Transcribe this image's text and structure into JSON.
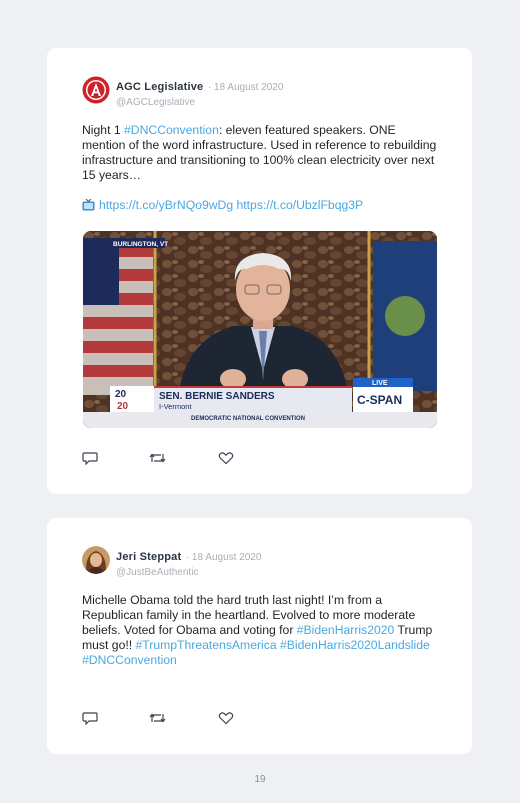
{
  "page_number": "19",
  "tweets": [
    {
      "name": "AGC Legislative",
      "date": "· 18 August 2020",
      "handle": "@AGCLegislative",
      "avatar_icon": "agc-logo-icon",
      "text_segments": [
        {
          "text": "Night 1 ",
          "tag": false
        },
        {
          "text": "#DNCConvention",
          "tag": true
        },
        {
          "text": ": eleven featured speakers. ONE mention of the word infrastructure. Used in reference to rebuilding infrastructure and transitioning to 100% clean electricity over next 15 years…",
          "tag": false
        }
      ],
      "links": "https://t.co/yBrNQo9wDg https://t.co/UbzlFbqg3P",
      "link_icon": "tv-icon",
      "media": {
        "location": "BURLINGTON, VT",
        "speaker_name": "SEN. BERNIE SANDERS",
        "speaker_state": "I-Vermont",
        "logo_top": "2020",
        "live": "LIVE",
        "network": "C-SPAN",
        "event": "DEMOCRATIC NATIONAL CONVENTION"
      }
    },
    {
      "name": "Jeri Steppat",
      "date": "· 18 August 2020",
      "handle": "@JustBeAuthentic",
      "avatar_icon": "user-photo-avatar",
      "text_segments": [
        {
          "text": "Michelle Obama told the hard truth last night! I’m from a Republican family in the heartland. Evolved to more moderate beliefs. Voted for Obama and voting for ",
          "tag": false
        },
        {
          "text": "#BidenHarris2020",
          "tag": true
        },
        {
          "text": " Trump must go!! ",
          "tag": false
        },
        {
          "text": "#TrumpThreatensAmerica",
          "tag": true
        },
        {
          "text": " ",
          "tag": false
        },
        {
          "text": "#BidenHarris2020Landslide",
          "tag": true
        },
        {
          "text": " ",
          "tag": false
        },
        {
          "text": "#DNCConvention",
          "tag": true
        }
      ]
    }
  ],
  "colors": {
    "background": "#eef0f3",
    "card": "#ffffff",
    "link": "#4aa8e0",
    "muted": "#a9afb8",
    "agc_red": "#d0202a"
  }
}
